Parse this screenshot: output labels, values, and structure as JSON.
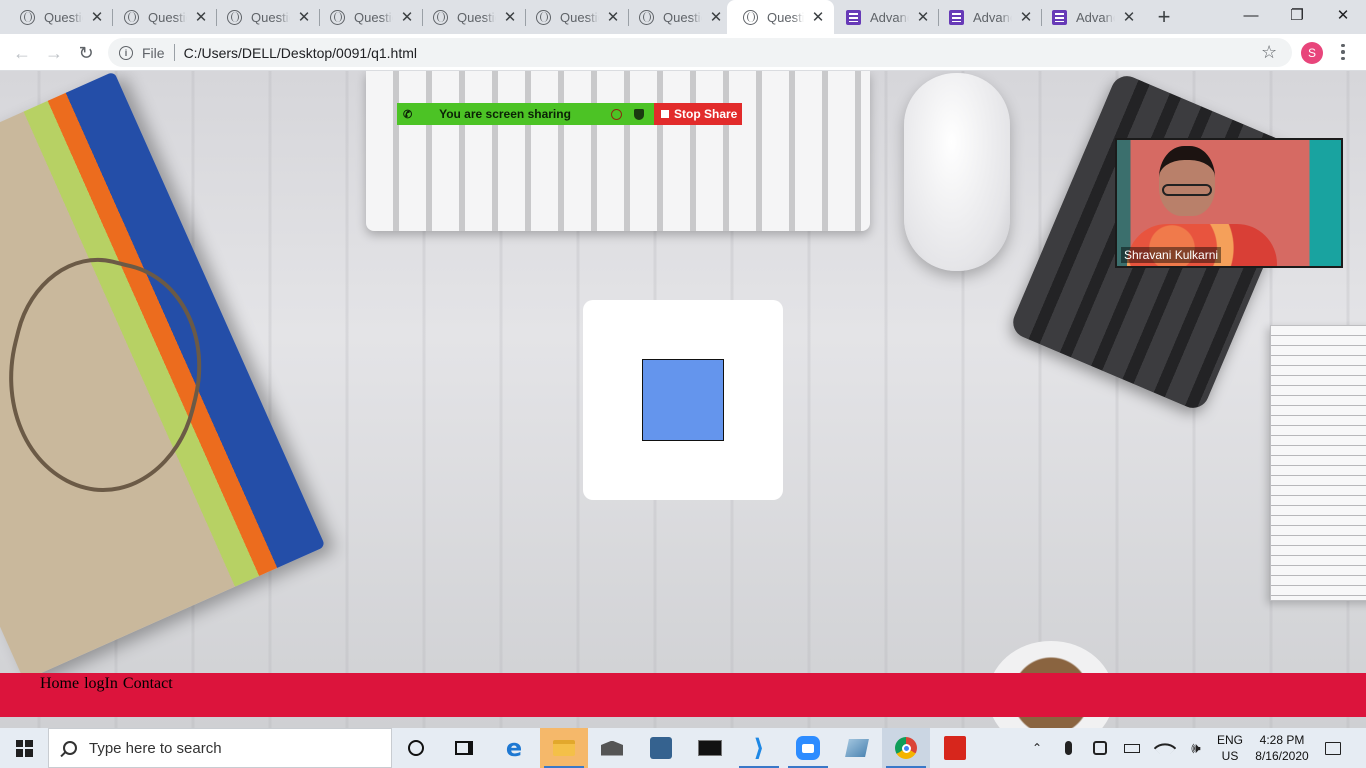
{
  "browser": {
    "tabs": [
      {
        "title": "Questio",
        "icon": "globe-icon",
        "active": false
      },
      {
        "title": "Questio",
        "icon": "globe-icon",
        "active": false
      },
      {
        "title": "Questio",
        "icon": "globe-icon",
        "active": false
      },
      {
        "title": "Questio",
        "icon": "globe-icon",
        "active": false
      },
      {
        "title": "Questio",
        "icon": "globe-icon",
        "active": false
      },
      {
        "title": "Questio",
        "icon": "globe-icon",
        "active": false
      },
      {
        "title": "Questio",
        "icon": "globe-icon",
        "active": false
      },
      {
        "title": "Questio",
        "icon": "globe-icon",
        "active": true
      },
      {
        "title": "Advanc",
        "icon": "form-icon",
        "active": false
      },
      {
        "title": "Advanc",
        "icon": "form-icon",
        "active": false
      },
      {
        "title": "Advanc",
        "icon": "form-icon",
        "active": false
      }
    ],
    "tab_close_glyph": "✕",
    "new_tab_glyph": "+",
    "scheme": "File",
    "url": "C:/Users/DELL/Desktop/0091/q1.html",
    "profile_initial": "S",
    "window_controls": {
      "minimize": "—",
      "maximize": "❐",
      "close": "✕"
    },
    "nav": {
      "back": "←",
      "forward": "→",
      "reload": "↻"
    },
    "star_glyph": "☆"
  },
  "zoom": {
    "sharing_text": "You are screen sharing",
    "stop_label": "Stop Share",
    "participant_name": "Shravani Kulkarni"
  },
  "page": {
    "nav_links": [
      "Home",
      "logIn",
      "Contact"
    ],
    "square_color": "#6495ed",
    "footer_color": "#dc143c"
  },
  "taskbar": {
    "search_placeholder": "Type here to search",
    "language_top": "ENG",
    "language_bottom": "US",
    "time": "4:28 PM",
    "date": "8/16/2020"
  },
  "colors": {
    "zoom_green": "#4cc325",
    "zoom_red": "#e22b2b",
    "profile": "#e8457b"
  }
}
